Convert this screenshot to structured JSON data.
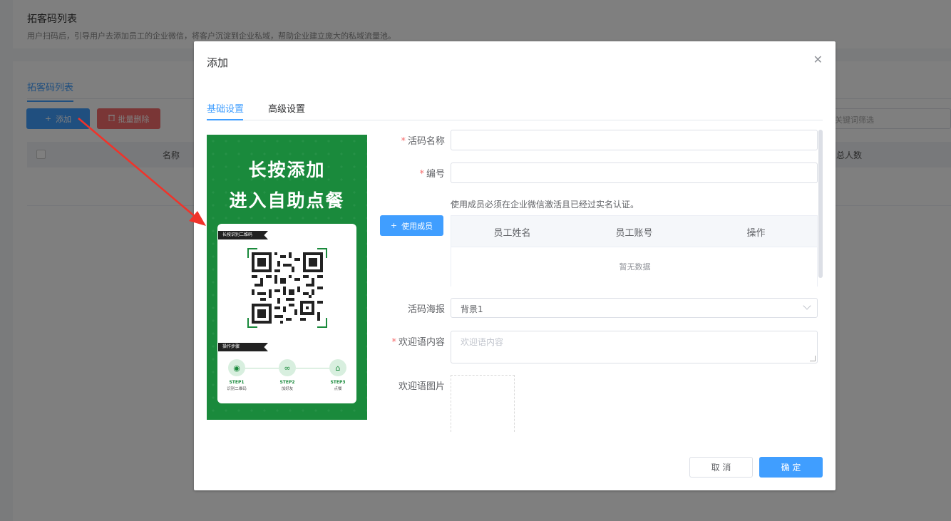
{
  "background": {
    "title": "拓客码列表",
    "description": "用户扫码后，引导用户去添加员工的企业微信，将客户沉淀到企业私域，帮助企业建立庞大的私域流量池。",
    "tab": "拓客码列表",
    "add_button": "添加",
    "batch_delete_button": "批量删除",
    "search_placeholder": "关键词筛选",
    "columns": {
      "name": "名称",
      "total": "总人数"
    }
  },
  "dialog": {
    "title": "添加",
    "tabs": [
      "基础设置",
      "高级设置"
    ],
    "active_tab": 0,
    "poster": {
      "title_line1": "长按添加",
      "title_line2": "进入自助点餐",
      "ribbon_scan": "长按识别二维码",
      "ribbon_steps": "操作步骤",
      "steps": [
        {
          "label": "STEP1",
          "desc": "识别二维码"
        },
        {
          "label": "STEP2",
          "desc": "加好友"
        },
        {
          "label": "STEP3",
          "desc": "点餐"
        }
      ]
    },
    "form": {
      "code_name_label": "活码名称",
      "number_label": "编号",
      "member_note": "使用成员必须在企业微信激活且已经过实名认证。",
      "use_member_button": "使用成员",
      "member_table": {
        "columns": [
          "员工姓名",
          "员工账号",
          "操作"
        ],
        "empty_text": "暂无数据"
      },
      "poster_label": "活码海报",
      "poster_value": "背景1",
      "welcome_label": "欢迎语内容",
      "welcome_placeholder": "欢迎语内容",
      "welcome_image_label": "欢迎语图片"
    },
    "cancel_button": "取 消",
    "ok_button": "确 定"
  },
  "colors": {
    "primary": "#409eff",
    "danger": "#f56c6c",
    "poster_green": "#1a8a3c",
    "arrow": "#f0332a"
  }
}
